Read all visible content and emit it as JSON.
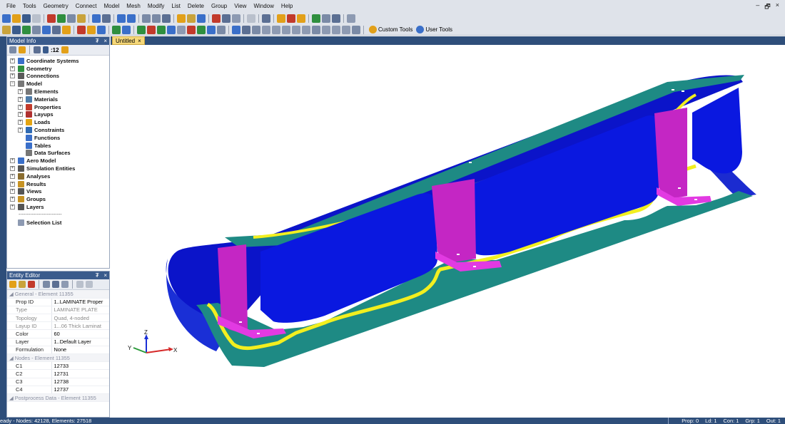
{
  "menu": [
    "File",
    "Tools",
    "Geometry",
    "Connect",
    "Model",
    "Mesh",
    "Modify",
    "List",
    "Delete",
    "Group",
    "View",
    "Window",
    "Help"
  ],
  "window_controls": [
    "–",
    "🗗",
    "×"
  ],
  "toolbar": {
    "custom_tools": "Custom Tools",
    "user_tools": "User Tools"
  },
  "model_info": {
    "title": "Model Info",
    "pin": "₮",
    "close": "×",
    "counter": ":12",
    "tree": [
      {
        "label": "Coordinate Systems",
        "level": 0,
        "expander": "+",
        "icon": "coordinate-systems-icon",
        "color": "#3a6fc9"
      },
      {
        "label": "Geometry",
        "level": 0,
        "expander": "+",
        "icon": "geometry-icon",
        "color": "#2f8f3f"
      },
      {
        "label": "Connections",
        "level": 0,
        "expander": "+",
        "icon": "connections-icon",
        "color": "#5a5a5a"
      },
      {
        "label": "Model",
        "level": 0,
        "expander": "−",
        "icon": "model-icon",
        "color": "#777777"
      },
      {
        "label": "Elements",
        "level": 1,
        "expander": "+",
        "icon": "elements-icon",
        "color": "#777777"
      },
      {
        "label": "Materials",
        "level": 1,
        "expander": "+",
        "icon": "materials-icon",
        "color": "#4d7ba8"
      },
      {
        "label": "Properties",
        "level": 1,
        "expander": "+",
        "icon": "properties-icon",
        "color": "#c23a2b"
      },
      {
        "label": "Layups",
        "level": 1,
        "expander": "+",
        "icon": "layups-icon",
        "color": "#b03030"
      },
      {
        "label": "Loads",
        "level": 1,
        "expander": "+",
        "icon": "loads-icon",
        "color": "#e3a413"
      },
      {
        "label": "Constraints",
        "level": 1,
        "expander": "+",
        "icon": "constraints-icon",
        "color": "#2f6ab3"
      },
      {
        "label": "Functions",
        "level": 1,
        "expander": "",
        "icon": "functions-icon",
        "color": "#3a6fc9"
      },
      {
        "label": "Tables",
        "level": 1,
        "expander": "",
        "icon": "tables-icon",
        "color": "#3a6fc9"
      },
      {
        "label": "Data Surfaces",
        "level": 1,
        "expander": "",
        "icon": "data-surfaces-icon",
        "color": "#777777"
      },
      {
        "label": "Aero Model",
        "level": 0,
        "expander": "+",
        "icon": "aero-model-icon",
        "color": "#3a6fc9"
      },
      {
        "label": "Simulation Entities",
        "level": 0,
        "expander": "+",
        "icon": "simulation-entities-icon",
        "color": "#555555"
      },
      {
        "label": "Analyses",
        "level": 0,
        "expander": "+",
        "icon": "analyses-icon",
        "color": "#8a6d2f"
      },
      {
        "label": "Results",
        "level": 0,
        "expander": "+",
        "icon": "results-icon",
        "color": "#c79324"
      },
      {
        "label": "Views",
        "level": 0,
        "expander": "+",
        "icon": "views-icon",
        "color": "#555555"
      },
      {
        "label": "Groups",
        "level": 0,
        "expander": "+",
        "icon": "groups-icon",
        "color": "#c79324"
      },
      {
        "label": "Layers",
        "level": 0,
        "expander": "+",
        "icon": "layers-icon",
        "color": "#555555"
      }
    ],
    "separator": "--------------------------",
    "selection_list": "Selection List"
  },
  "entity_editor": {
    "title": "Entity Editor",
    "pin": "₮",
    "close": "×",
    "sections": [
      {
        "header": "General - Element 11355",
        "rows": [
          {
            "key": "Prop ID",
            "value": "1..LAMINATE Proper",
            "dim": false
          },
          {
            "key": "Type",
            "value": "LAMINATE PLATE",
            "dim": true
          },
          {
            "key": "Topology",
            "value": "Quad, 4-noded",
            "dim": true
          },
          {
            "key": "Layup ID",
            "value": "1...06 Thick Laminat",
            "dim": true
          },
          {
            "key": "Color",
            "value": "60",
            "dim": false
          },
          {
            "key": "Layer",
            "value": "1..Default Layer",
            "dim": false
          },
          {
            "key": "Formulation",
            "value": "None",
            "dim": false
          }
        ]
      },
      {
        "header": "Nodes - Element 11355",
        "rows": [
          {
            "key": "C1",
            "value": "12733",
            "dim": false
          },
          {
            "key": "C2",
            "value": "12731",
            "dim": false
          },
          {
            "key": "C3",
            "value": "12738",
            "dim": false
          },
          {
            "key": "C4",
            "value": "12737",
            "dim": false
          }
        ]
      },
      {
        "header": "Postprocess Data - Element 11355",
        "rows": []
      }
    ]
  },
  "doc_tab": {
    "label": "Untitled",
    "close": "×"
  },
  "triad": {
    "x": "X",
    "y": "Y",
    "z": "Z"
  },
  "colors": {
    "frame": "#2e4e7a",
    "skin_blue": "#0b14c9",
    "flange_teal": "#1e8a84",
    "frame_magenta": "#c426c4",
    "adhesive_yellow": "#f2ef1f"
  },
  "status": {
    "left": "eady - Nodes: 42128,  Elements: 27518",
    "right": [
      "Prop: 0",
      "Ld: 1",
      "Con: 1",
      "Grp: 1",
      "Out: 1"
    ]
  }
}
